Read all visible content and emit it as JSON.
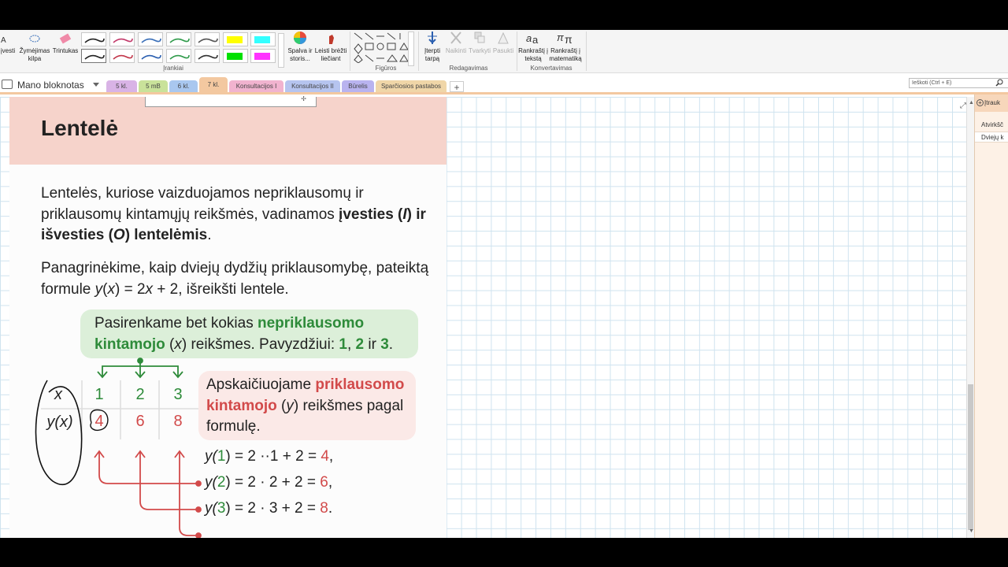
{
  "ribbon": {
    "btn_ivesti": "įvesti",
    "btn_zymejimas": "Žymėjimas kilpa",
    "btn_trintukas": "Trintukas",
    "btn_spalva": "Spalva ir storis...",
    "btn_leisti": "Leisti brėžti liečiant",
    "btn_iterpti": "Įterpti tarpą",
    "btn_naikinti": "Naikinti",
    "btn_tvarkyti": "Tvarkyti",
    "btn_pasukti": "Pasukti",
    "btn_rankrastis_tekstas": "Rankraštį į tekstą",
    "btn_rankrastis_matematika": "Rankraštį į matematiką",
    "grp_irankiai": "Įrankiai",
    "grp_figuros": "Figūros",
    "grp_redagavimas": "Redagavimas",
    "grp_konvertavimas": "Konvertavimas",
    "pen_colors": [
      "#222222",
      "#c23a6a",
      "#3a6fb8",
      "#2f9a4a",
      "#555555",
      "#222222",
      "#c2364a",
      "#2b5fb0",
      "#2f9a4a",
      "#333333"
    ],
    "highlighter_colors": [
      "#ffff00",
      "#33ffff",
      "#00e000",
      "#ff33ff"
    ]
  },
  "notebook": {
    "name": "Mano bloknotas",
    "tabs": [
      {
        "label": "5 kl.",
        "color": "#d9b3e6"
      },
      {
        "label": "5 mB",
        "color": "#c9e29a"
      },
      {
        "label": "6 kl.",
        "color": "#a9c7ef"
      },
      {
        "label": "7 kl.",
        "color": "#f3c8a0"
      },
      {
        "label": "Konsultacijos I",
        "color": "#f1b3cf"
      },
      {
        "label": "Konsultacijos II",
        "color": "#b6c4ef"
      },
      {
        "label": "Būrelis",
        "color": "#b9b3ef"
      },
      {
        "label": "Sparčiosios pastabos",
        "color": "#f0d6a8"
      }
    ],
    "add_tab": "+",
    "search_placeholder": "Ieškoti (Ctrl + E)"
  },
  "slide": {
    "title": "Lentelė",
    "p1_a": "Lentelės, kuriose vaizduojamos nepriklausomų ir priklausomų kintamųjų reikšmės, vadinamos ",
    "p1_b": "įvesties (",
    "p1_c": "I",
    "p1_d": ") ir išvesties (",
    "p1_e": "O",
    "p1_f": ") lentelėmis",
    "p1_g": ".",
    "p2_a": "Panagrinėkime, kaip dviejų dydžių priklausomybę, pateiktą formule ",
    "p2_b": "y",
    "p2_c": "(",
    "p2_d": "x",
    "p2_e": ") = 2",
    "p2_f": "x",
    "p2_g": " + 2, išreikšti lentele.",
    "green_a": "Pasirenkame bet kokias ",
    "green_b": "nepriklausomo kintamojo",
    "green_c": " (",
    "green_d": "x",
    "green_e": ") reikšmes. Pavyzdžiui: ",
    "green_f": "1",
    "green_g": ", ",
    "green_h": "2",
    "green_i": " ir ",
    "green_j": "3",
    "green_k": ".",
    "red_a": "Apskaičiuojame ",
    "red_b": "priklausomo kintamojo",
    "red_c": " (",
    "red_d": "y",
    "red_e": ") reikšmes pagal formulę.",
    "table": {
      "row1_label": "x",
      "row2_label": "y(x)",
      "x_values": [
        "1",
        "2",
        "3"
      ],
      "y_values": [
        "4",
        "6",
        "8"
      ]
    },
    "eq1": {
      "a": "y(",
      "b": "1",
      "c": ") = 2 ··1 + 2 = ",
      "d": "4",
      "e": ","
    },
    "eq2": {
      "a": "y(",
      "b": "2",
      "c": ") = 2 · 2 + 2 = ",
      "d": "6",
      "e": ","
    },
    "eq3": {
      "a": "y(",
      "b": "3",
      "c": ") = 2 · 3 + 2 = ",
      "d": "8",
      "e": "."
    }
  },
  "rightpane": {
    "top": "Įtrauk",
    "item1": "Atvirkšč",
    "item2": "Dviejų k"
  },
  "colors": {
    "accent_green": "#2e8b3a",
    "accent_red": "#d24a4a",
    "title_band": "#f6d3cb"
  }
}
